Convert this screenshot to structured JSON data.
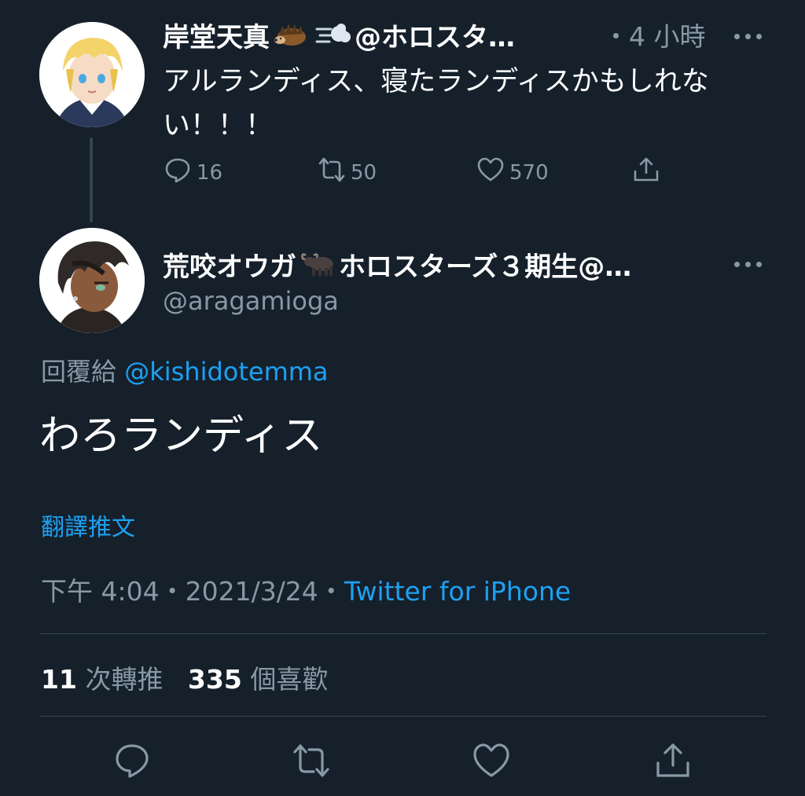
{
  "parent_tweet": {
    "display_name": "岸堂天真",
    "emoji_1": "hedgehog",
    "emoji_2": "dash",
    "name_suffix": "@ホロスタ…",
    "time": "・4 小時",
    "text": "アルランディス、寝たランディスかもしれない！！！",
    "replies": "16",
    "retweets": "50",
    "likes": "570"
  },
  "main_tweet": {
    "display_name": "荒咬オウガ",
    "emoji": "water-buffalo",
    "name_suffix": "ホロスターズ３期生@…",
    "handle": "@aragamioga",
    "reply_prefix": "回覆給",
    "reply_to": "@kishidotemma",
    "text": "わろランディス",
    "translate": "翻譯推文",
    "time": "下午 4:04・2021/3/24・",
    "source": "Twitter for iPhone",
    "retweet_count": "11",
    "retweet_label": "次轉推",
    "like_count": "335",
    "like_label": "個喜歡"
  },
  "colors": {
    "background": "#15202b",
    "text": "#ffffff",
    "secondary": "#8899a6",
    "accent": "#1da1f2",
    "divider": "#38444d"
  },
  "icons": [
    "reply-icon",
    "retweet-icon",
    "like-icon",
    "share-icon",
    "more-icon"
  ]
}
